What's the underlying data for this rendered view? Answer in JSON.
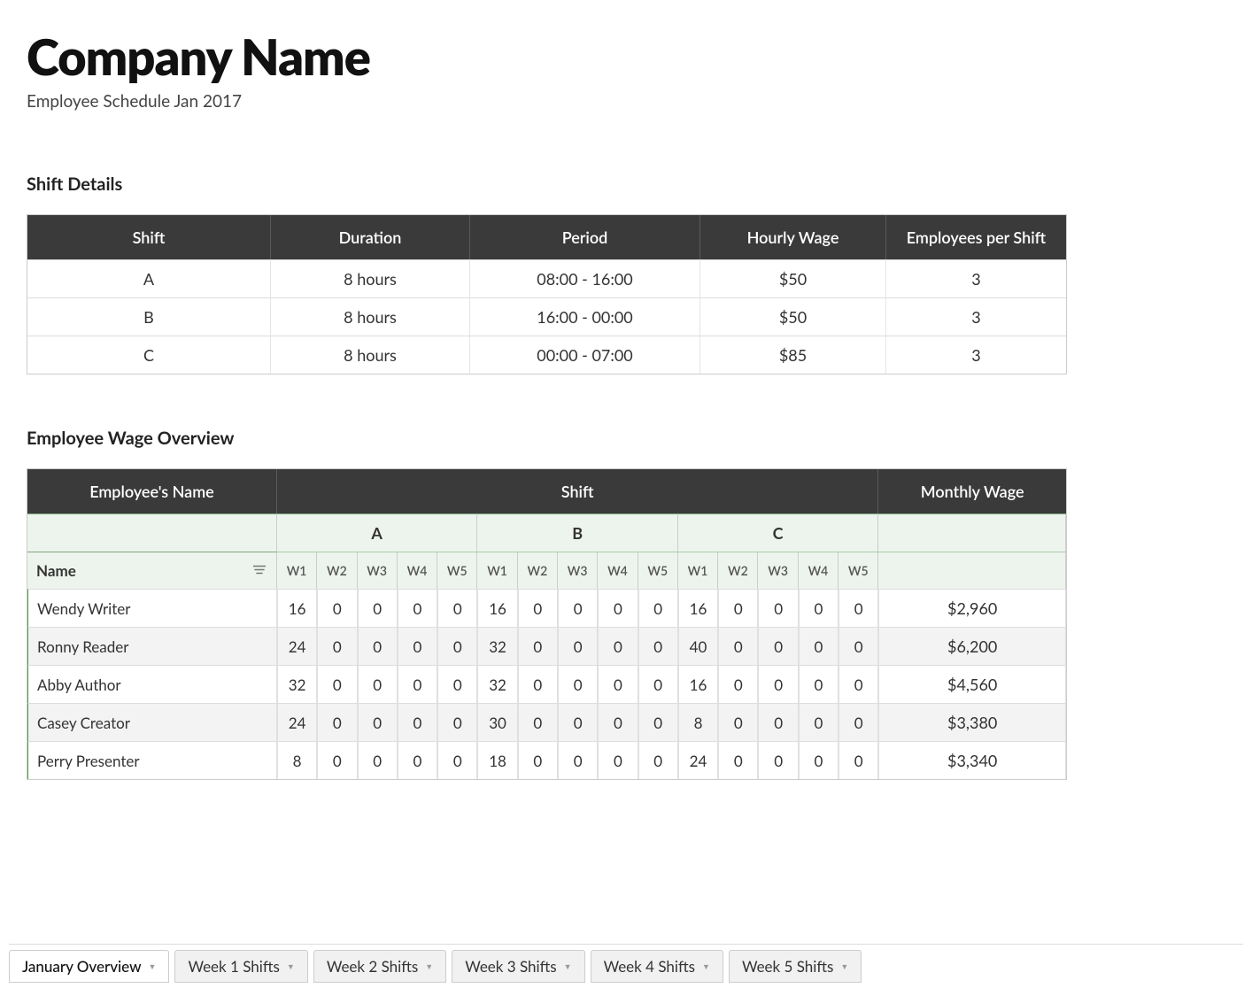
{
  "header": {
    "title": "Company Name",
    "subtitle": "Employee Schedule Jan 2017"
  },
  "shift_details": {
    "heading": "Shift Details",
    "columns": {
      "shift": "Shift",
      "duration": "Duration",
      "period": "Period",
      "wage": "Hourly Wage",
      "per_shift": "Employees per Shift"
    },
    "rows": [
      {
        "shift": "A",
        "duration": "8 hours",
        "period": "08:00 - 16:00",
        "wage": "$50",
        "per_shift": "3"
      },
      {
        "shift": "B",
        "duration": "8 hours",
        "period": "16:00 - 00:00",
        "wage": "$50",
        "per_shift": "3"
      },
      {
        "shift": "C",
        "duration": "8 hours",
        "period": "00:00 - 07:00",
        "wage": "$85",
        "per_shift": "3"
      }
    ]
  },
  "wage_overview": {
    "heading": "Employee Wage Overview",
    "columns": {
      "employee_name": "Employee's Name",
      "shift": "Shift",
      "monthly_wage": "Monthly Wage",
      "name": "Name",
      "groups": {
        "a": "A",
        "b": "B",
        "c": "C"
      },
      "weeks": {
        "w1": "W1",
        "w2": "W2",
        "w3": "W3",
        "w4": "W4",
        "w5": "W5"
      }
    },
    "rows": [
      {
        "name": "Wendy Writer",
        "a": [
          "16",
          "0",
          "0",
          "0",
          "0"
        ],
        "b": [
          "16",
          "0",
          "0",
          "0",
          "0"
        ],
        "c": [
          "16",
          "0",
          "0",
          "0",
          "0"
        ],
        "wage": "$2,960"
      },
      {
        "name": "Ronny Reader",
        "a": [
          "24",
          "0",
          "0",
          "0",
          "0"
        ],
        "b": [
          "32",
          "0",
          "0",
          "0",
          "0"
        ],
        "c": [
          "40",
          "0",
          "0",
          "0",
          "0"
        ],
        "wage": "$6,200"
      },
      {
        "name": "Abby Author",
        "a": [
          "32",
          "0",
          "0",
          "0",
          "0"
        ],
        "b": [
          "32",
          "0",
          "0",
          "0",
          "0"
        ],
        "c": [
          "16",
          "0",
          "0",
          "0",
          "0"
        ],
        "wage": "$4,560"
      },
      {
        "name": "Casey Creator",
        "a": [
          "24",
          "0",
          "0",
          "0",
          "0"
        ],
        "b": [
          "30",
          "0",
          "0",
          "0",
          "0"
        ],
        "c": [
          "8",
          "0",
          "0",
          "0",
          "0"
        ],
        "wage": "$3,380"
      },
      {
        "name": "Perry Presenter",
        "a": [
          "8",
          "0",
          "0",
          "0",
          "0"
        ],
        "b": [
          "18",
          "0",
          "0",
          "0",
          "0"
        ],
        "c": [
          "24",
          "0",
          "0",
          "0",
          "0"
        ],
        "wage": "$3,340"
      }
    ]
  },
  "tabs": [
    {
      "label": "January Overview",
      "active": true
    },
    {
      "label": "Week 1 Shifts",
      "active": false
    },
    {
      "label": "Week 2 Shifts",
      "active": false
    },
    {
      "label": "Week 3 Shifts",
      "active": false
    },
    {
      "label": "Week 4 Shifts",
      "active": false
    },
    {
      "label": "Week 5 Shifts",
      "active": false
    }
  ]
}
